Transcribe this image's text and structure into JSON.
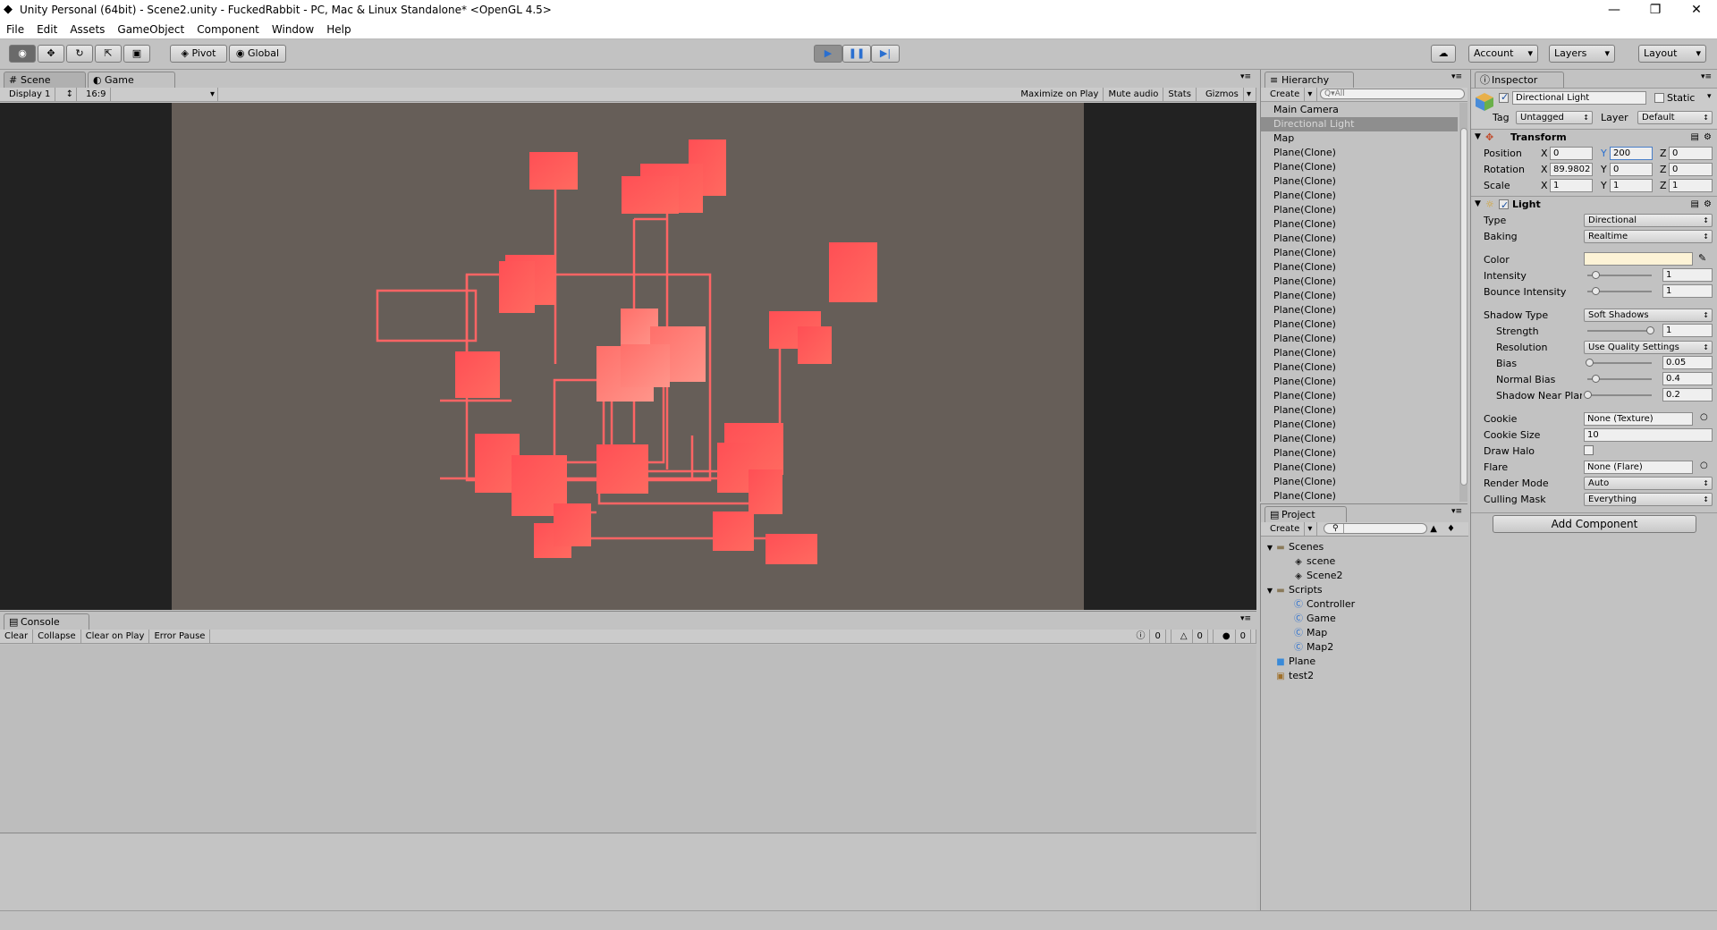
{
  "window": {
    "title": "Unity Personal (64bit) - Scene2.unity - FuckedRabbit - PC, Mac & Linux Standalone* <OpenGL 4.5>",
    "minimize": "—",
    "maximize": "❐",
    "close": "✕"
  },
  "menu": [
    "File",
    "Edit",
    "Assets",
    "GameObject",
    "Component",
    "Window",
    "Help"
  ],
  "toolbar": {
    "pivot": "Pivot",
    "global": "Global",
    "account": "Account",
    "layers": "Layers",
    "layout": "Layout"
  },
  "tabs": {
    "scene": "Scene",
    "game": "Game",
    "console": "Console",
    "hierarchy": "Hierarchy",
    "project": "Project",
    "inspector": "Inspector"
  },
  "game_bar": {
    "display": "Display 1",
    "aspect": "16:9",
    "maximize": "Maximize on Play",
    "mute": "Mute audio",
    "stats": "Stats",
    "gizmos": "Gizmos"
  },
  "console_bar": {
    "clear": "Clear",
    "collapse": "Collapse",
    "clear_on_play": "Clear on Play",
    "error_pause": "Error Pause",
    "info_count": "0",
    "warn_count": "0",
    "error_count": "0"
  },
  "hierarchy": {
    "create": "Create",
    "search_placeholder": "Q▾All",
    "items": [
      "Main Camera",
      "Directional Light",
      "Map",
      "Plane(Clone)",
      "Plane(Clone)",
      "Plane(Clone)",
      "Plane(Clone)",
      "Plane(Clone)",
      "Plane(Clone)",
      "Plane(Clone)",
      "Plane(Clone)",
      "Plane(Clone)",
      "Plane(Clone)",
      "Plane(Clone)",
      "Plane(Clone)",
      "Plane(Clone)",
      "Plane(Clone)",
      "Plane(Clone)",
      "Plane(Clone)",
      "Plane(Clone)",
      "Plane(Clone)",
      "Plane(Clone)",
      "Plane(Clone)",
      "Plane(Clone)",
      "Plane(Clone)",
      "Plane(Clone)",
      "Plane(Clone)",
      "Plane(Clone)"
    ],
    "selected_index": 1
  },
  "project": {
    "create": "Create",
    "items": [
      {
        "label": "Scenes",
        "icon": "folder",
        "depth": 0,
        "arrow": "▼"
      },
      {
        "label": "scene",
        "icon": "unity",
        "depth": 1,
        "arrow": ""
      },
      {
        "label": "Scene2",
        "icon": "unity",
        "depth": 1,
        "arrow": ""
      },
      {
        "label": "Scripts",
        "icon": "folder",
        "depth": 0,
        "arrow": "▼"
      },
      {
        "label": "Controller",
        "icon": "script",
        "depth": 1,
        "arrow": ""
      },
      {
        "label": "Game",
        "icon": "script",
        "depth": 1,
        "arrow": ""
      },
      {
        "label": "Map",
        "icon": "script",
        "depth": 1,
        "arrow": ""
      },
      {
        "label": "Map2",
        "icon": "script",
        "depth": 1,
        "arrow": ""
      },
      {
        "label": "Plane",
        "icon": "prefab",
        "depth": 0,
        "arrow": ""
      },
      {
        "label": "test2",
        "icon": "texture",
        "depth": 0,
        "arrow": ""
      }
    ]
  },
  "inspector": {
    "object_name": "Directional Light",
    "static_label": "Static",
    "tag_label": "Tag",
    "tag_value": "Untagged",
    "layer_label": "Layer",
    "layer_value": "Default",
    "transform": {
      "title": "Transform",
      "position_label": "Position",
      "rotation_label": "Rotation",
      "scale_label": "Scale",
      "position": {
        "x": "0",
        "y": "200",
        "z": "0"
      },
      "rotation": {
        "x": "89.9802",
        "y": "0",
        "z": "0"
      },
      "scale": {
        "x": "1",
        "y": "1",
        "z": "1"
      }
    },
    "light": {
      "title": "Light",
      "type_label": "Type",
      "type_value": "Directional",
      "baking_label": "Baking",
      "baking_value": "Realtime",
      "color_label": "Color",
      "color_value": "#fdf3d6",
      "intensity_label": "Intensity",
      "intensity_value": "1",
      "intensity_fraction": 0.125,
      "bounce_label": "Bounce Intensity",
      "bounce_value": "1",
      "bounce_fraction": 0.125,
      "shadow_type_label": "Shadow Type",
      "shadow_type_value": "Soft Shadows",
      "strength_label": "Strength",
      "strength_value": "1",
      "strength_fraction": 1.0,
      "resolution_label": "Resolution",
      "resolution_value": "Use Quality Settings",
      "bias_label": "Bias",
      "bias_value": "0.05",
      "bias_fraction": 0.025,
      "normal_bias_label": "Normal Bias",
      "normal_bias_value": "0.4",
      "normal_bias_fraction": 0.13,
      "near_plane_label": "Shadow Near Plar",
      "near_plane_value": "0.2",
      "near_plane_fraction": 0.0,
      "cookie_label": "Cookie",
      "cookie_value": "None (Texture)",
      "cookie_size_label": "Cookie Size",
      "cookie_size_value": "10",
      "draw_halo_label": "Draw Halo",
      "flare_label": "Flare",
      "flare_value": "None (Flare)",
      "render_mode_label": "Render Mode",
      "render_mode_value": "Auto",
      "culling_mask_label": "Culling Mask",
      "culling_mask_value": "Everything"
    },
    "add_component": "Add Component"
  },
  "colors": {
    "game_bg": "#665e58",
    "tile": "#ff5a5a",
    "tile_light": "#ff8a80",
    "line": "#ff6464",
    "play_active": "#4a7fc8"
  }
}
